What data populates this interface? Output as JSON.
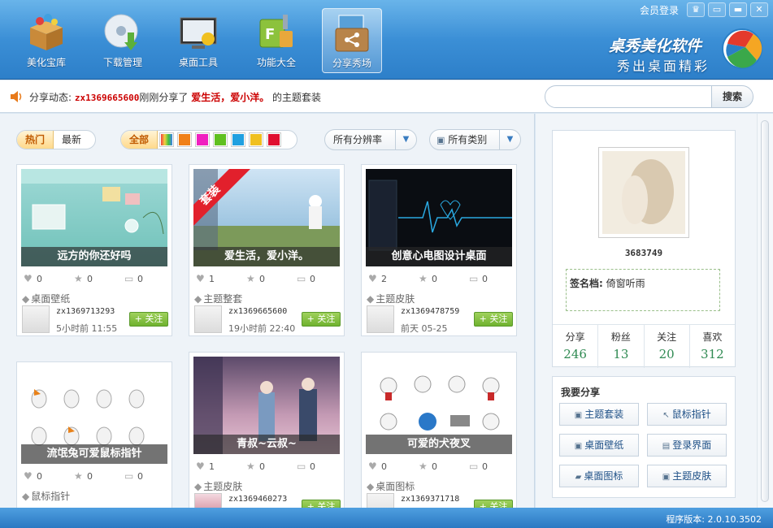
{
  "app": {
    "brand_main": "桌秀美化软件",
    "brand_sub": "秀出桌面精彩"
  },
  "toolbar": {
    "items": [
      {
        "label": "美化宝库",
        "icon": "treasure-box-icon"
      },
      {
        "label": "下载管理",
        "icon": "download-disc-icon"
      },
      {
        "label": "桌面工具",
        "icon": "desktop-monitor-icon"
      },
      {
        "label": "功能大全",
        "icon": "tools-icon"
      },
      {
        "label": "分享秀场",
        "icon": "share-icon"
      }
    ],
    "active_index": 4,
    "member_login": "会员登录"
  },
  "share_feed": {
    "prefix": "分享动态:",
    "user": "zx1369665600",
    "middle": "刚刚分享了",
    "theme_name": "爱生活，爱小洋。",
    "suffix": "的主题套装"
  },
  "search": {
    "placeholder": "",
    "button": "搜索"
  },
  "filters": {
    "sort_hot": "热门",
    "sort_new": "最新",
    "color_all": "全部",
    "colors": [
      "#f0d040",
      "#f08018",
      "#f020c0",
      "#60c020",
      "#20a0e0",
      "#f0c020",
      "#e01030"
    ],
    "resolution": "所有分辨率",
    "category": "所有类别"
  },
  "cards": [
    {
      "caption": "远方的你还好吗",
      "likes": "0",
      "stars": "0",
      "comments": "0",
      "category": "桌面壁纸",
      "user": "zx1369713293",
      "time": "5小时前 11:55",
      "follow": "关注",
      "ribbon": ""
    },
    {
      "caption": "爱生活，爱小洋。",
      "likes": "1",
      "stars": "0",
      "comments": "0",
      "category": "主题整套",
      "user": "zx1369665600",
      "time": "19小时前 22:40",
      "follow": "关注",
      "ribbon": "套装"
    },
    {
      "caption": "创意心电图设计桌面",
      "likes": "2",
      "stars": "0",
      "comments": "0",
      "category": "主题皮肤",
      "user": "zx1369478759",
      "time": "前天 05-25",
      "follow": "关注",
      "ribbon": ""
    },
    {
      "caption": "流氓兔可爱鼠标指针",
      "likes": "0",
      "stars": "0",
      "comments": "0",
      "category": "鼠标指针",
      "user": "",
      "time": "",
      "follow": "",
      "ribbon": ""
    },
    {
      "caption": "青叔~云叔~",
      "likes": "1",
      "stars": "0",
      "comments": "0",
      "category": "主题皮肤",
      "user": "zx1369460273",
      "time": "",
      "follow": "关注",
      "ribbon": ""
    },
    {
      "caption": "可爱的犬夜叉",
      "likes": "0",
      "stars": "0",
      "comments": "0",
      "category": "桌面图标",
      "user": "zx1369371718",
      "time": "",
      "follow": "关注",
      "ribbon": ""
    }
  ],
  "profile": {
    "id": "3683749",
    "signature_label": "签名档:",
    "signature": "倚窗听雨",
    "stats": [
      {
        "label": "分享",
        "value": "246"
      },
      {
        "label": "粉丝",
        "value": "13"
      },
      {
        "label": "关注",
        "value": "20"
      },
      {
        "label": "喜欢",
        "value": "312"
      }
    ]
  },
  "my_share": {
    "title": "我要分享",
    "buttons": [
      "主题套装",
      "鼠标指针",
      "桌面壁纸",
      "登录界面",
      "桌面图标",
      "主题皮肤"
    ]
  },
  "status": {
    "version": "程序版本: 2.0.10.3502"
  }
}
